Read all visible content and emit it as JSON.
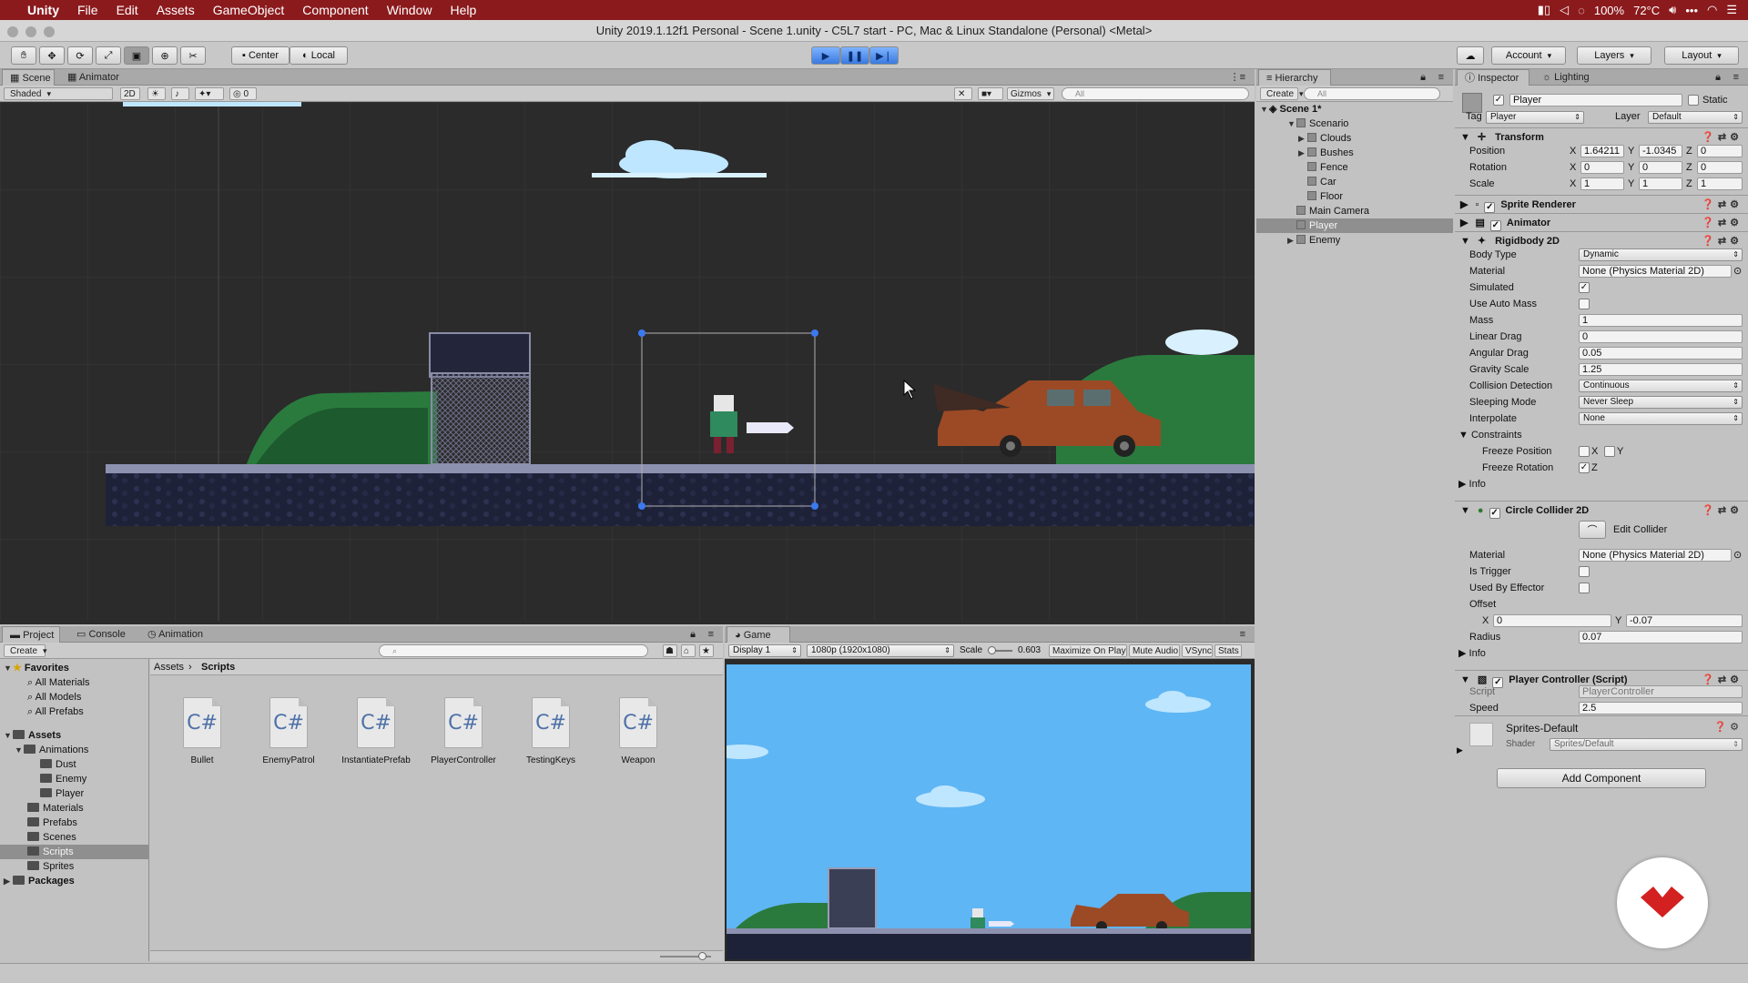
{
  "menubar": {
    "app": "Unity",
    "items": [
      "File",
      "Edit",
      "Assets",
      "GameObject",
      "Component",
      "Window",
      "Help"
    ],
    "battery": "100%",
    "temp": "72°C"
  },
  "window": {
    "title": "Unity 2019.1.12f1 Personal - Scene 1.unity - C5L7 start - PC, Mac & Linux Standalone (Personal) <Metal>"
  },
  "toolbar": {
    "pivot": "Center",
    "space": "Local",
    "account": "Account",
    "layers": "Layers",
    "layout": "Layout"
  },
  "scene": {
    "tabs": [
      "Scene",
      "Animator"
    ],
    "shading": "Shaded",
    "mode2d": "2D",
    "fx_count": "0",
    "gizmos": "Gizmos",
    "search_placeholder": "All"
  },
  "hierarchy": {
    "tab": "Hierarchy",
    "create": "Create",
    "search_placeholder": "All",
    "scene": "Scene 1*",
    "items": [
      "Scenario",
      "Clouds",
      "Bushes",
      "Fence",
      "Car",
      "Floor",
      "Main Camera",
      "Player",
      "Enemy"
    ]
  },
  "inspector": {
    "tabs": [
      "Inspector",
      "Lighting"
    ],
    "object_name": "Player",
    "static": "Static",
    "tag_label": "Tag",
    "tag": "Player",
    "layer_label": "Layer",
    "layer": "Default",
    "transform": {
      "title": "Transform",
      "rows": [
        {
          "label": "Position",
          "x": "1.64211",
          "y": "-1.0345",
          "z": "0"
        },
        {
          "label": "Rotation",
          "x": "0",
          "y": "0",
          "z": "0"
        },
        {
          "label": "Scale",
          "x": "1",
          "y": "1",
          "z": "1"
        }
      ]
    },
    "sprite_renderer": "Sprite Renderer",
    "animator": "Animator",
    "rigidbody": {
      "title": "Rigidbody 2D",
      "body_type_label": "Body Type",
      "body_type": "Dynamic",
      "material_label": "Material",
      "material": "None (Physics Material 2D)",
      "simulated_label": "Simulated",
      "auto_mass_label": "Use Auto Mass",
      "mass_label": "Mass",
      "mass": "1",
      "linear_drag_label": "Linear Drag",
      "linear_drag": "0",
      "angular_drag_label": "Angular Drag",
      "angular_drag": "0.05",
      "gravity_label": "Gravity Scale",
      "gravity": "1.25",
      "collision_label": "Collision Detection",
      "collision": "Continuous",
      "sleeping_label": "Sleeping Mode",
      "sleeping": "Never Sleep",
      "interpolate_label": "Interpolate",
      "interpolate": "None",
      "constraints": "Constraints",
      "freeze_pos": "Freeze Position",
      "freeze_rot": "Freeze Rotation",
      "info": "Info"
    },
    "circle": {
      "title": "Circle Collider 2D",
      "edit": "Edit Collider",
      "material_label": "Material",
      "material": "None (Physics Material 2D)",
      "trigger_label": "Is Trigger",
      "effector_label": "Used By Effector",
      "offset_label": "Offset",
      "offset_x": "0",
      "offset_y": "-0.07",
      "radius_label": "Radius",
      "radius": "0.07",
      "info": "Info"
    },
    "script": {
      "title": "Player Controller (Script)",
      "script_label": "Script",
      "script": "PlayerController",
      "speed_label": "Speed",
      "speed": "2.5"
    },
    "material": {
      "name": "Sprites-Default",
      "shader_label": "Shader",
      "shader": "Sprites/Default"
    },
    "add_component": "Add Component"
  },
  "project": {
    "tabs": [
      "Project",
      "Console",
      "Animation"
    ],
    "create": "Create",
    "breadcrumb": [
      "Assets",
      "Scripts"
    ],
    "favorites": {
      "title": "Favorites",
      "items": [
        "All Materials",
        "All Models",
        "All Prefabs"
      ]
    },
    "assets": {
      "title": "Assets",
      "items": [
        "Animations",
        "Dust",
        "Enemy",
        "Player",
        "Materials",
        "Prefabs",
        "Scenes",
        "Scripts",
        "Sprites"
      ]
    },
    "packages": "Packages",
    "files": [
      "Bullet",
      "EnemyPatrol",
      "InstantiatePrefab",
      "PlayerController",
      "TestingKeys",
      "Weapon"
    ],
    "file_icon": "C#"
  },
  "game": {
    "tab": "Game",
    "display": "Display 1",
    "resolution": "1080p (1920x1080)",
    "scale_label": "Scale",
    "scale": "0.603",
    "maximize": "Maximize On Play",
    "mute": "Mute Audio",
    "vsync": "VSync",
    "stats": "Stats"
  },
  "colors": {
    "menubar": "#8b1a1d",
    "scene_bg": "#2b2b2b",
    "game_sky": "#5fb6f4",
    "selection": "#8f8f8f"
  }
}
